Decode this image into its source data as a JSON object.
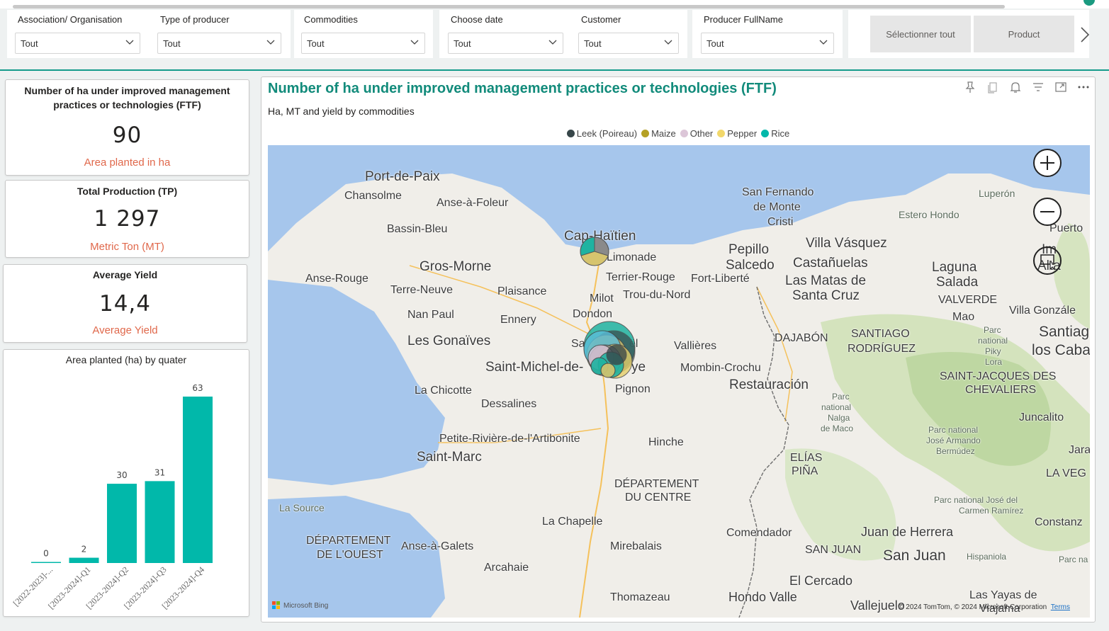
{
  "filters": [
    {
      "label": "Association/ Organisation",
      "value": "Tout"
    },
    {
      "label": "Type of producer",
      "value": "Tout"
    },
    {
      "label": "Commodities",
      "value": "Tout"
    },
    {
      "label": "Choose date",
      "value": "Tout"
    },
    {
      "label": "Customer",
      "value": "Tout"
    },
    {
      "label": "Producer FullName",
      "value": "Tout"
    }
  ],
  "buttons": {
    "select_all": "Sélectionner tout",
    "product": "Product"
  },
  "kpis": [
    {
      "title": "Number of ha under improved management practices or technologies (FTF)",
      "value": "90",
      "subtitle": "Area planted in ha"
    },
    {
      "title": "Total Production (TP)",
      "value": "1 297",
      "subtitle": "Metric Ton (MT)"
    },
    {
      "title": "Average Yield",
      "value": "14,4",
      "subtitle": "Average Yield"
    }
  ],
  "chart_data": {
    "type": "bar",
    "title": "Area planted (ha) by quater",
    "categories": [
      "[2022-2023]-...",
      "[2023-2024]-Q1",
      "[2023-2024]-Q2",
      "[2023-2024]-Q3",
      "[2023-2024]-Q4"
    ],
    "values": [
      0,
      2,
      30,
      31,
      63
    ],
    "ylim": [
      0,
      63
    ],
    "color": "#01b8aa",
    "grid": false
  },
  "map_visual": {
    "title": "Number of ha under improved management practices or technologies (FTF)",
    "subtitle": "Ha, MT and yield by commodities",
    "legend": [
      {
        "name": "Leek (Poireau)",
        "color": "#374649"
      },
      {
        "name": "Maize",
        "color": "#b5a125"
      },
      {
        "name": "Other",
        "color": "#dcc6d8"
      },
      {
        "name": "Pepper",
        "color": "#f2d86b"
      },
      {
        "name": "Rice",
        "color": "#01b8aa"
      }
    ],
    "toolbar_icons": [
      "pin-icon",
      "copy-icon",
      "bell-icon",
      "filter-icon",
      "focus-mode-icon",
      "more-options-icon"
    ],
    "attribution": "© 2024 TomTom, © 2024 Microsoft Corporation",
    "terms": "Terms",
    "bing_logo": "Microsoft Bing",
    "places": {
      "port_de_paix": "Port-de-Paix",
      "chansolme": "Chansolme",
      "anse_a_foleur": "Anse-à-Foleur",
      "bassin_bleu": "Bassin-Bleu",
      "cap_haitien": "Cap-Haïtien",
      "limonade": "Limonade",
      "gros_morne": "Gros-Morne",
      "anse_rouge": "Anse-Rouge",
      "terre_neuve": "Terre-Neuve",
      "plaisance": "Plaisance",
      "terrier_rouge": "Terrier-Rouge",
      "fort_liberte": "Fort-Liberté",
      "milot": "Milot",
      "trou_du_nord": "Trou-du-Nord",
      "nan_paul": "Nan Paul",
      "ennery": "Ennery",
      "dondon": "Dondon",
      "les_gonaives": "Les Gonaïves",
      "vallieres": "Vallières",
      "saint_michel": "Saint-Michel-de-",
      "mombin_crochu": "Mombin-Crochu",
      "la_chicotte": "La Chicotte",
      "pignon": "Pignon",
      "restauracion": "Restauración",
      "dessalines": "Dessalines",
      "petite_riviere": "Petite-Rivière-de-l'Artibonite",
      "saint_marc": "Saint-Marc",
      "hinche": "Hinche",
      "departement_centre_1": "DÉPARTEMENT",
      "departement_centre_2": "DU CENTRE",
      "la_source": "La Source",
      "la_chapelle": "La Chapelle",
      "departement_ouest_1": "DÉPARTEMENT",
      "departement_ouest_2": "DE L'OUEST",
      "anse_a_galets": "Anse-à-Galets",
      "mirebalais": "Mirebalais",
      "arcahaie": "Arcahaie",
      "thomazeau": "Thomazeau",
      "san_fernando_1": "San Fernando",
      "san_fernando_2": "de Monte",
      "san_fernando_3": "Cristi",
      "luperon": "Luperón",
      "estero_hondo": "Estero Hondo",
      "puerto": "Puerto",
      "villa_vasquez": "Villa Vásquez",
      "pepillo_1": "Pepillo",
      "pepillo_2": "Salcedo",
      "castanuelas": "Castañuelas",
      "laguna_1": "Laguna",
      "laguna_2": "Salada",
      "las_matas_1": "Las Matas de",
      "las_matas_2": "Santa Cruz",
      "valverde": "VALVERDE",
      "mao": "Mao",
      "villa_gonzalez": "Villa Gonzále",
      "dajabon": "DAJABÓN",
      "santiago_r_1": "SANTIAGO",
      "santiago_r_2": "RODRÍGUEZ",
      "parc_piky_1": "Parc",
      "parc_piky_2": "national",
      "parc_piky_3": "Piky",
      "parc_piky_4": "Lora",
      "santiago_1": "Santiag",
      "santiago_2": "los Caba",
      "saint_jacques_1": "SAINT-JACQUES DES",
      "saint_jacques_2": "CHEVALIERS",
      "parc_nalga_1": "Parc",
      "parc_nalga_2": "national",
      "parc_nalga_3": "Nalga",
      "parc_nalga_4": "de Maco",
      "juncalito": "Juncalito",
      "parc_jose_armando_1": "Parc national",
      "parc_jose_armando_2": "José Armando",
      "parc_jose_armando_3": "Bermúdez",
      "jara": "Jara",
      "la_vega": "LA VEG",
      "elias_pina_1": "ELÍAS",
      "elias_pina_2": "PIÑA",
      "parc_carmen_1": "Parc national José del",
      "parc_carmen_2": "Carmen Ramírez",
      "constanza": "Constanz",
      "comendador": "Comendador",
      "juan_de_herrera": "Juan de Herrera",
      "san_juan_region": "SAN JUAN",
      "san_juan": "San Juan",
      "hispaniola": "Hispaniola",
      "parc_na": "Parc na",
      "el_cercado": "El Cercado",
      "hondo_valle": "Hondo Valle",
      "vallejuelo": "Vallejuelo",
      "las_yayas_1": "Las Yayas de",
      "las_yayas_2": "Viajama",
      "imbert": "Im",
      "altamira": "Alta",
      "saint_raphael": "Sa",
      "saint_raphael_2": "ël",
      "saint_michel_end": "ye"
    }
  }
}
